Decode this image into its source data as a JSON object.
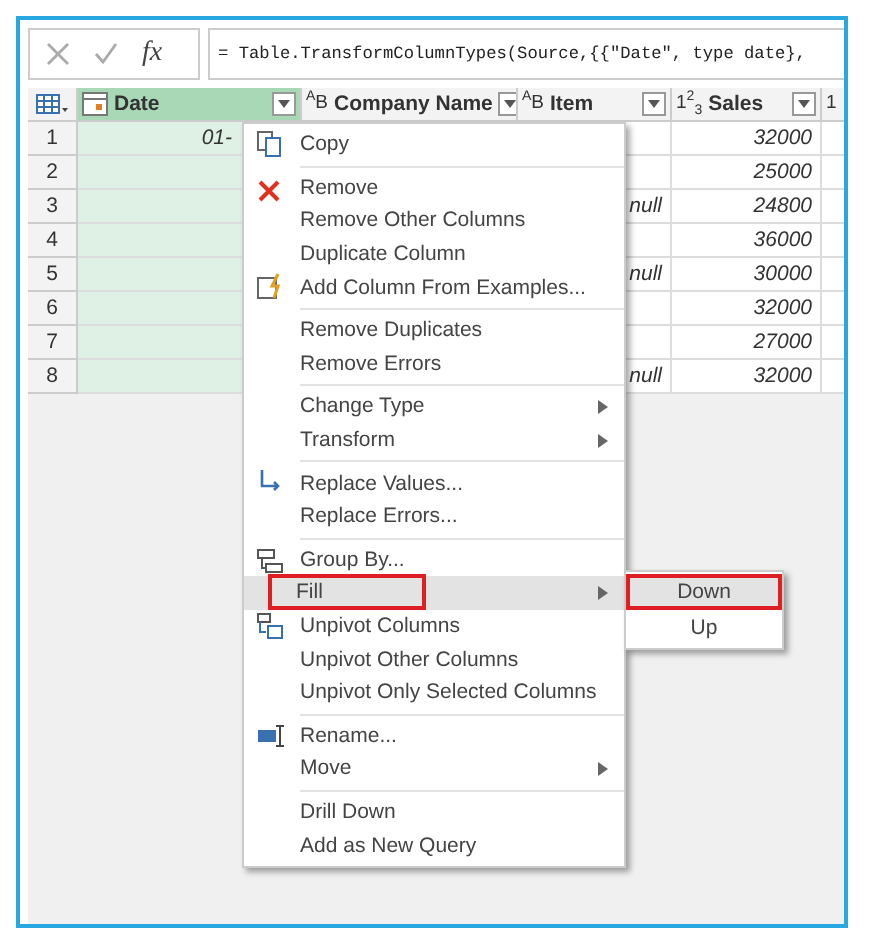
{
  "formula_bar": {
    "fx_label": "fx",
    "formula": "= Table.TransformColumnTypes(Source,{{\"Date\", type date},"
  },
  "table": {
    "columns": [
      {
        "name": "Date",
        "selected": true,
        "kind": "date"
      },
      {
        "type_label": "$^{A}$B",
        "name": "Company Name",
        "selected": false,
        "kind": "text"
      },
      {
        "type_label": "$^{A}$B",
        "name": "Item",
        "selected": false,
        "kind": "text"
      },
      {
        "type_label": "1$^{2}$$_{3}$",
        "name": "Sales",
        "selected": false,
        "kind": "number"
      },
      {
        "type_label": "1",
        "selected": false,
        "kind": "number"
      }
    ],
    "rows": [
      {
        "num": "1",
        "date": "01-",
        "sales": "32000"
      },
      {
        "num": "2",
        "sales": "25000"
      },
      {
        "num": "3",
        "item": "null",
        "sales": "24800"
      },
      {
        "num": "4",
        "sales": "36000"
      },
      {
        "num": "5",
        "item": "null",
        "sales": "30000"
      },
      {
        "num": "6",
        "sales": "32000"
      },
      {
        "num": "7",
        "sales": "27000"
      },
      {
        "num": "8",
        "item": "null",
        "sales": "32000"
      }
    ]
  },
  "context_menu": {
    "groups": [
      [
        {
          "label": "Copy",
          "kind": "copy"
        }
      ],
      [
        {
          "label": "Remove",
          "kind": "remove"
        },
        {
          "label": "Remove Other Columns",
          "kind": "plain"
        },
        {
          "label": "Duplicate Column",
          "kind": "plain"
        },
        {
          "label": "Add Column From Examples...",
          "kind": "examples"
        }
      ],
      [
        {
          "label": "Remove Duplicates",
          "kind": "plain"
        },
        {
          "label": "Remove Errors",
          "kind": "plain"
        }
      ],
      [
        {
          "label": "Change Type",
          "kind": "plain",
          "submenu": true
        },
        {
          "label": "Transform",
          "kind": "plain",
          "submenu": true
        }
      ],
      [
        {
          "label": "Replace Values...",
          "kind": "replace"
        },
        {
          "label": "Replace Errors...",
          "kind": "plain"
        }
      ],
      [
        {
          "label": "Group By...",
          "kind": "group"
        },
        {
          "label": "Fill",
          "kind": "plain",
          "submenu": true,
          "selected": true,
          "annotated": true
        },
        {
          "label": "Unpivot Columns",
          "kind": "unpivot"
        },
        {
          "label": "Unpivot Other Columns",
          "kind": "plain"
        },
        {
          "label": "Unpivot Only Selected Columns",
          "kind": "plain"
        }
      ],
      [
        {
          "label": "Rename...",
          "kind": "rename"
        },
        {
          "label": "Move",
          "kind": "plain",
          "submenu": true
        }
      ],
      [
        {
          "label": "Drill Down",
          "kind": "plain"
        },
        {
          "label": "Add as New Query",
          "kind": "plain"
        }
      ]
    ]
  },
  "fill_submenu": {
    "items": [
      {
        "label": "Down",
        "selected": true,
        "annotated": true
      },
      {
        "label": "Up",
        "selected": false,
        "annotated": false
      }
    ]
  }
}
